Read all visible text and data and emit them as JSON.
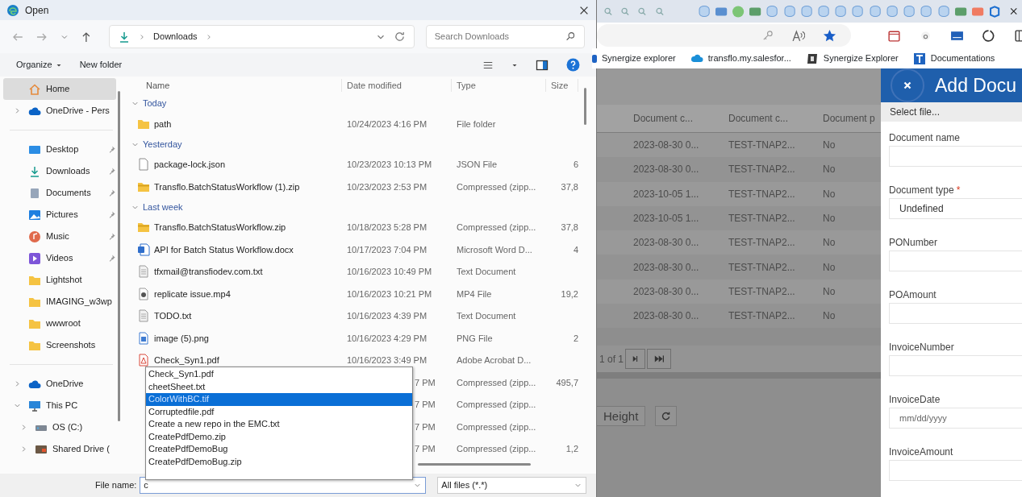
{
  "dialog": {
    "title": "Open",
    "nav": {
      "path": "Downloads",
      "search_placeholder": "Search Downloads"
    },
    "toolbar": {
      "organize": "Organize",
      "new_folder": "New folder"
    },
    "sidebar": [
      {
        "items": [
          {
            "label": "Home",
            "kind": "home",
            "selected": true
          },
          {
            "label": "OneDrive - Pers",
            "kind": "cloud",
            "selected": false,
            "expanded": false
          }
        ]
      },
      {
        "items": [
          {
            "label": "Desktop",
            "kind": "desktop",
            "selected": false,
            "pinned": true
          },
          {
            "label": "Downloads",
            "kind": "download",
            "selected": false,
            "pinned": true
          },
          {
            "label": "Documents",
            "kind": "documents",
            "selected": false,
            "pinned": true
          },
          {
            "label": "Pictures",
            "kind": "pictures",
            "selected": false,
            "pinned": true
          },
          {
            "label": "Music",
            "kind": "music",
            "selected": false,
            "pinned": true
          },
          {
            "label": "Videos",
            "kind": "videos",
            "selected": false,
            "pinned": true
          },
          {
            "label": "Lightshot",
            "kind": "folder",
            "selected": false,
            "pinned": false
          },
          {
            "label": "IMAGING_w3wp",
            "kind": "folder",
            "selected": false,
            "pinned": false
          },
          {
            "label": "wwwroot",
            "kind": "folder",
            "selected": false,
            "pinned": false
          },
          {
            "label": "Screenshots",
            "kind": "folder",
            "selected": false,
            "pinned": false
          }
        ]
      },
      {
        "items": [
          {
            "label": "OneDrive",
            "kind": "cloud",
            "selected": false,
            "expanded": false
          },
          {
            "label": "This PC",
            "kind": "pc",
            "selected": false,
            "expanded": true,
            "children": [
              {
                "label": "OS (C:)",
                "kind": "drive",
                "selected": false,
                "expanded": false
              },
              {
                "label": "Shared Drive (",
                "kind": "netdrive",
                "selected": false,
                "expanded": false
              }
            ]
          }
        ]
      }
    ],
    "columns": [
      "Name",
      "Date modified",
      "Type",
      "Size"
    ],
    "groups": [
      {
        "label": "Today",
        "expanded": true,
        "files": [
          {
            "name": "path",
            "kind": "folder",
            "date": "10/24/2023 4:16 PM",
            "type": "File folder"
          }
        ]
      },
      {
        "label": "Yesterday",
        "expanded": true,
        "files": [
          {
            "name": "package-lock.json",
            "kind": "file",
            "date": "10/23/2023 10:13 PM",
            "type": "JSON File",
            "size": "6"
          },
          {
            "name": "Transflo.BatchStatusWorkflow (1).zip",
            "kind": "zip",
            "date": "10/23/2023 2:53 PM",
            "type": "Compressed (zipp...",
            "size": "37,8"
          }
        ]
      },
      {
        "label": "Last week",
        "expanded": true,
        "files": [
          {
            "name": "Transflo.BatchStatusWorkflow.zip",
            "kind": "zip",
            "date": "10/18/2023 5:28 PM",
            "type": "Compressed (zipp...",
            "size": "37,8"
          },
          {
            "name": "API for Batch Status Workflow.docx",
            "kind": "word",
            "date": "10/17/2023 7:04 PM",
            "type": "Microsoft Word D...",
            "size": "4"
          },
          {
            "name": "tfxmail@transfiodev.com.txt",
            "kind": "text",
            "date": "10/16/2023 10:49 PM",
            "type": "Text Document"
          },
          {
            "name": "replicate issue.mp4",
            "kind": "video",
            "date": "10/16/2023 10:21 PM",
            "type": "MP4 File",
            "size": "19,2"
          },
          {
            "name": "TODO.txt",
            "kind": "text",
            "date": "10/16/2023 4:39 PM",
            "type": "Text Document"
          },
          {
            "name": "image (5).png",
            "kind": "image",
            "date": "10/16/2023 4:29 PM",
            "type": "PNG File",
            "size": "2"
          },
          {
            "name": "Check_Syn1.pdf",
            "kind": "pdf",
            "date": "10/16/2023 3:49 PM",
            "type": "Adobe Acrobat D..."
          },
          {
            "date": "7 PM",
            "type": "Compressed (zipp...",
            "size": "495,7"
          },
          {
            "date": "7 PM",
            "type": "Compressed (zipp..."
          },
          {
            "date": "7 PM",
            "type": "Compressed (zipp..."
          },
          {
            "date": "7 PM",
            "type": "Compressed (zipp...",
            "size": "1,2"
          }
        ]
      }
    ],
    "autocomplete": [
      {
        "label": "Check_Syn1.pdf",
        "selected": false
      },
      {
        "label": "cheetSheet.txt",
        "selected": false
      },
      {
        "label": "ColorWithBC.tif",
        "selected": true
      },
      {
        "label": "Corruptedfile.pdf",
        "selected": false
      },
      {
        "label": "Create a new repo in the EMC.txt",
        "selected": false
      },
      {
        "label": "CreatePdfDemo.zip",
        "selected": false
      },
      {
        "label": "CreatePdfDemoBug",
        "selected": false
      },
      {
        "label": "CreatePdfDemoBug.zip",
        "selected": false
      }
    ],
    "file_name": {
      "label": "File name:",
      "value": "c"
    },
    "filter": "All files (*.*)"
  },
  "browser": {
    "bookmarks": [
      {
        "label": "Synergize explorer",
        "kind": "partial"
      },
      {
        "label": "transflo.my.salesfor...",
        "kind": "cloud"
      },
      {
        "label": "Synergize Explorer",
        "kind": "square"
      },
      {
        "label": "Documentations",
        "kind": "tile"
      }
    ],
    "grid": {
      "columns": [
        "Document c...",
        "Document c...",
        "Document p"
      ],
      "rows": [
        [
          "2023-08-30 0...",
          "TEST-TNAP2...",
          "No"
        ],
        [
          "2023-08-30 0...",
          "TEST-TNAP2...",
          "No"
        ],
        [
          "2023-10-05 1...",
          "TEST-TNAP2...",
          "No"
        ],
        [
          "2023-10-05 1...",
          "TEST-TNAP2...",
          "No"
        ],
        [
          "2023-08-30 0...",
          "TEST-TNAP2...",
          "No"
        ],
        [
          "2023-08-30 0...",
          "TEST-TNAP2...",
          "No"
        ],
        [
          "2023-08-30 0...",
          "TEST-TNAP2...",
          "No"
        ],
        [
          "2023-08-30 0...",
          "TEST-TNAP2...",
          "No"
        ]
      ]
    },
    "pager": "1 of 1",
    "height_button": "Height",
    "panel": {
      "title": "Add Docu",
      "select_file": "Select file...",
      "fields": [
        {
          "label": "Document name",
          "kind": "text"
        },
        {
          "label": "Document type",
          "kind": "select",
          "required_mark": "*",
          "value": "Undefined"
        },
        {
          "label": "PONumber",
          "kind": "text"
        },
        {
          "label": "POAmount",
          "kind": "text"
        },
        {
          "label": "InvoiceNumber",
          "kind": "text"
        },
        {
          "label": "InvoiceDate",
          "kind": "date",
          "placeholder": "mm/dd/yyyy"
        },
        {
          "label": "InvoiceAmount",
          "kind": "text"
        }
      ]
    }
  }
}
